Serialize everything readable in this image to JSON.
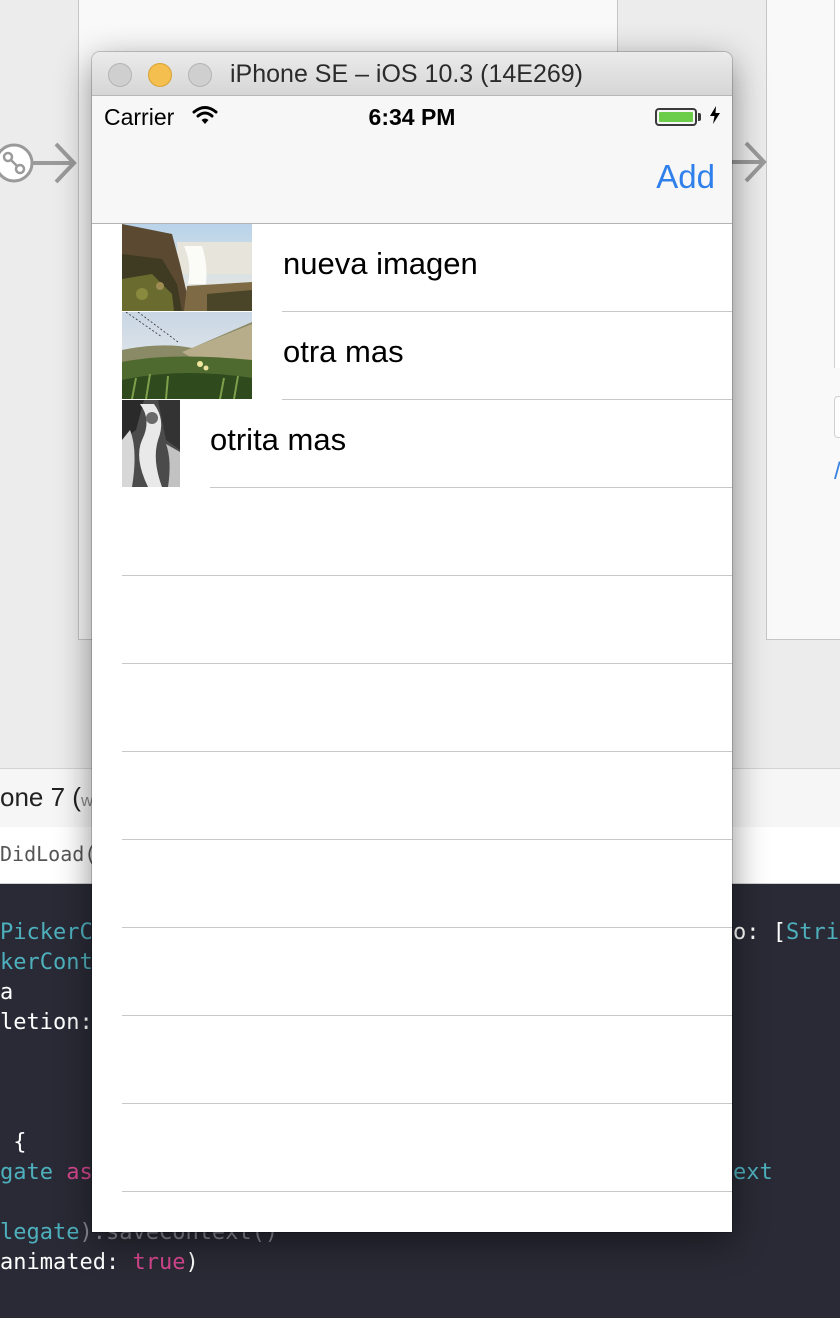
{
  "window": {
    "title": "iPhone SE – iOS 10.3 (14E269)"
  },
  "status_bar": {
    "carrier": "Carrier",
    "time": "6:34 PM",
    "battery_level": 1.0,
    "charging": true
  },
  "nav_bar": {
    "add_label": "Add"
  },
  "table": {
    "rows": [
      {
        "title": "nueva imagen"
      },
      {
        "title": "otra mas"
      },
      {
        "title": "otrita mas"
      }
    ]
  },
  "background": {
    "device_label": "one 7 (",
    "device_label_suffix": "w",
    "jump_bar_label": "DidLoad()",
    "code_lines": [
      {
        "a": "PickerC",
        "b": "",
        "c": "o: [Stri"
      },
      {
        "a": "kerCont",
        "b": "",
        "c": ""
      },
      {
        "a": "a",
        "b": "",
        "c": ""
      },
      {
        "a": "letion:",
        "b": "",
        "c": ""
      },
      {
        "a": " {",
        "b": "",
        "c": ""
      },
      {
        "a": "gate ",
        "b": "as",
        "c": "ext"
      },
      {
        "a": "legate",
        "b": ").saveContext()",
        "c": ""
      },
      {
        "a": "animated: ",
        "b": "true",
        "c": ")"
      }
    ]
  },
  "colors": {
    "accent": "#2f80ea",
    "battery_fill": "#6ccd4b",
    "minimize_button": "#f4bf4f",
    "code_background": "#292a35"
  }
}
